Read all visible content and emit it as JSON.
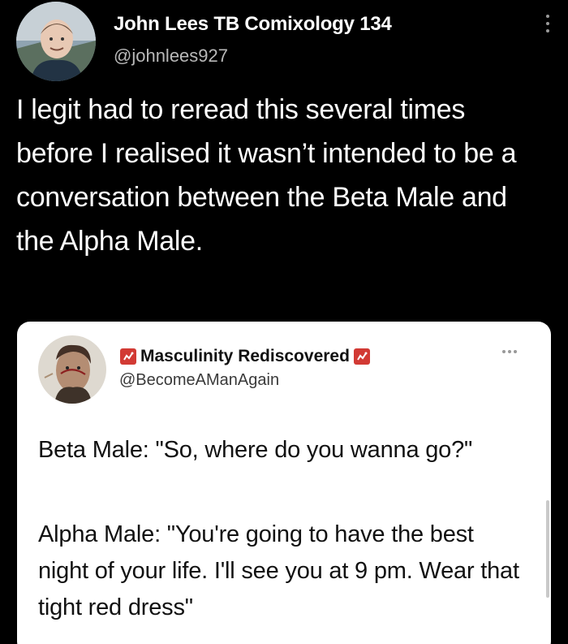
{
  "outer_tweet": {
    "author_name": "John Lees TB Comixology 134",
    "handle": "@johnlees927",
    "text": "I legit had to reread this several times before I realised it wasn’t intended to be a conversation between the Beta Male and the Alpha Male."
  },
  "quoted_tweet": {
    "author_name": "Masculinity Rediscovered",
    "handle": "@BecomeAManAgain",
    "line_1": "Beta Male: \"So, where do you wanna go?\"",
    "line_2": "Alpha Male: \"You're going to have the best night of your life. I'll see you at 9 pm. Wear that tight red dress\""
  },
  "icons": {
    "outer_more": "more-vertical-icon",
    "quote_more": "more-horizontal-icon",
    "badge": "masculinity-logo-icon"
  },
  "colors": {
    "background": "#000000",
    "card_background": "#ffffff",
    "text_on_dark": "#ffffff",
    "text_on_light": "#111111",
    "handle_on_dark": "#b8b8b8",
    "handle_on_light": "#3a3a3a",
    "accent_red": "#d23a34"
  }
}
